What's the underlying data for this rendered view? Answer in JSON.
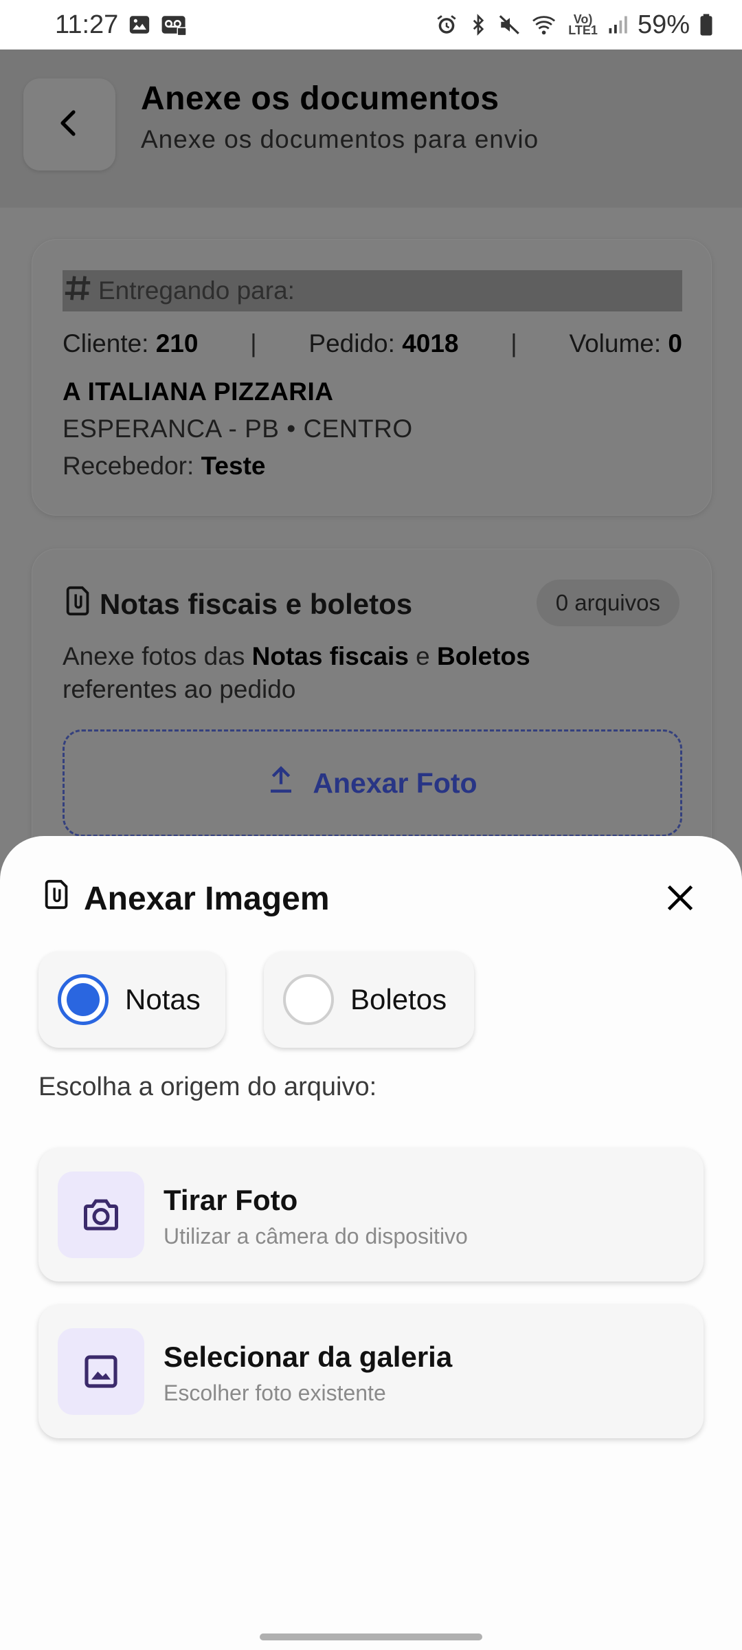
{
  "status_bar": {
    "time": "11:27",
    "battery": "59%",
    "network_top": "Vo)",
    "network_bottom": "LTE1",
    "icons": [
      "image-icon",
      "voicemail-icon",
      "alarm-icon",
      "bluetooth-icon",
      "mute-icon",
      "wifi-icon",
      "signal-icon",
      "battery-icon"
    ]
  },
  "header": {
    "title": "Anexe os documentos",
    "subtitle": "Anexe os documentos para envio"
  },
  "delivery": {
    "label": "Entregando para:",
    "cliente_label": "Cliente: ",
    "cliente_value": "210",
    "pedido_label": "Pedido: ",
    "pedido_value": "4018",
    "volume_label": "Volume: ",
    "volume_value": "0",
    "separator": "|",
    "client_name": "A ITALIANA PIZZARIA",
    "city": "ESPERANCA - PB • CENTRO",
    "receiver_label": "Recebedor: ",
    "receiver_value": "Teste"
  },
  "docs": {
    "title": "Notas fiscais e boletos",
    "badge": "0 arquivos",
    "desc_part1": "Anexe fotos das ",
    "desc_bold1": "Notas fiscais",
    "desc_part2": " e ",
    "desc_bold2": "Boletos",
    "desc_part3": " referentes ao pedido",
    "attach_button": "Anexar Foto"
  },
  "sheet": {
    "title": "Anexar Imagem",
    "options": [
      {
        "label": "Notas",
        "selected": true
      },
      {
        "label": "Boletos",
        "selected": false
      }
    ],
    "origin_label": "Escolha a origem do arquivo:",
    "sources": [
      {
        "title": "Tirar Foto",
        "subtitle": "Utilizar a câmera do dispositivo",
        "icon": "camera-icon"
      },
      {
        "title": "Selecionar da galeria",
        "subtitle": "Escolher foto existente",
        "icon": "gallery-icon"
      }
    ]
  },
  "colors": {
    "accent": "#2a66e0",
    "attach_button": "#283585",
    "icon_bg": "#ece8fb",
    "icon_fg": "#3b2a6b"
  }
}
